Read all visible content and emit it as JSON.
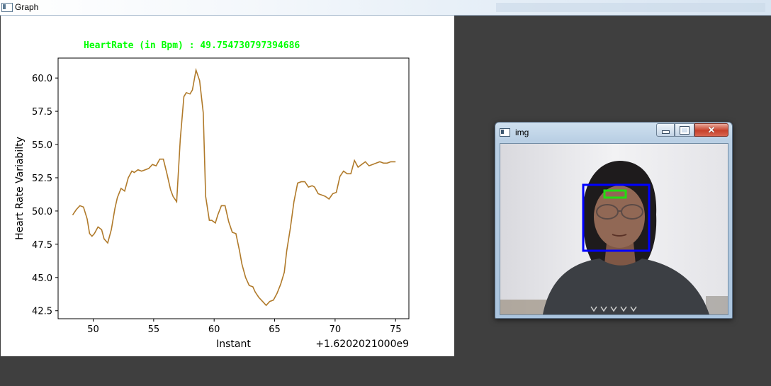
{
  "graph_window": {
    "title": "Graph",
    "overlay_text": "HeartRate (in Bpm) : 49.754730797394686"
  },
  "img_window": {
    "title": "img",
    "close_glyph": "✕"
  },
  "colors": {
    "line": "#b07a2a",
    "overlay_text": "#00ff00",
    "face_box": "#0000ff",
    "forehead_box": "#22dd11"
  },
  "chart_data": {
    "type": "line",
    "xlabel": "Instant",
    "ylabel": "Heart Rate Variabilty",
    "x_offset_label": "+1.6202021000e9",
    "xlim": [
      47.1,
      76.1
    ],
    "ylim": [
      41.9,
      61.5
    ],
    "xticks": [
      50,
      55,
      60,
      65,
      70,
      75
    ],
    "xtick_labels": [
      "50",
      "55",
      "60",
      "65",
      "70",
      "75"
    ],
    "yticks": [
      42.5,
      45.0,
      47.5,
      50.0,
      52.5,
      55.0,
      57.5,
      60.0
    ],
    "ytick_labels": [
      "42.5",
      "45.0",
      "47.5",
      "50.0",
      "52.5",
      "55.0",
      "57.5",
      "60.0"
    ],
    "x": [
      48.3,
      48.6,
      48.9,
      49.2,
      49.5,
      49.7,
      49.9,
      50.1,
      50.4,
      50.7,
      50.9,
      51.2,
      51.5,
      51.8,
      52.0,
      52.3,
      52.6,
      52.9,
      53.2,
      53.4,
      53.7,
      54.0,
      54.3,
      54.6,
      54.9,
      55.2,
      55.5,
      55.8,
      56.1,
      56.4,
      56.6,
      56.9,
      57.2,
      57.5,
      57.7,
      58.0,
      58.2,
      58.5,
      58.8,
      59.1,
      59.3,
      59.6,
      59.8,
      60.1,
      60.3,
      60.6,
      60.9,
      61.2,
      61.5,
      61.8,
      62.1,
      62.3,
      62.6,
      62.9,
      63.2,
      63.4,
      63.7,
      64.0,
      64.3,
      64.6,
      64.9,
      65.2,
      65.5,
      65.8,
      66.0,
      66.3,
      66.6,
      66.9,
      67.2,
      67.5,
      67.8,
      68.1,
      68.3,
      68.6,
      68.9,
      69.2,
      69.5,
      69.8,
      70.1,
      70.4,
      70.7,
      71.0,
      71.3,
      71.6,
      71.9,
      72.2,
      72.5,
      72.8,
      73.1,
      73.4,
      73.7,
      74.0,
      74.3,
      74.6,
      75.0
    ],
    "y": [
      49.7,
      50.1,
      50.4,
      50.3,
      49.4,
      48.3,
      48.1,
      48.3,
      48.8,
      48.6,
      47.9,
      47.6,
      48.6,
      50.2,
      51.0,
      51.7,
      51.5,
      52.5,
      53.0,
      52.9,
      53.1,
      53.0,
      53.1,
      53.2,
      53.5,
      53.4,
      53.9,
      53.9,
      52.8,
      51.6,
      51.1,
      50.7,
      55.4,
      58.6,
      58.9,
      58.8,
      59.1,
      60.6,
      59.8,
      57.4,
      51.1,
      49.3,
      49.3,
      49.1,
      49.7,
      50.4,
      50.4,
      49.2,
      48.4,
      48.3,
      47.0,
      46.0,
      45.0,
      44.4,
      44.3,
      43.9,
      43.5,
      43.2,
      42.9,
      43.2,
      43.3,
      43.8,
      44.5,
      45.4,
      47.0,
      48.7,
      50.7,
      52.1,
      52.2,
      52.2,
      51.8,
      51.9,
      51.8,
      51.3,
      51.2,
      51.1,
      50.9,
      51.3,
      51.4,
      52.6,
      53.0,
      52.8,
      52.8,
      53.8,
      53.3,
      53.5,
      53.7,
      53.4,
      53.5,
      53.6,
      53.7,
      53.6,
      53.6,
      53.7,
      53.7
    ]
  }
}
